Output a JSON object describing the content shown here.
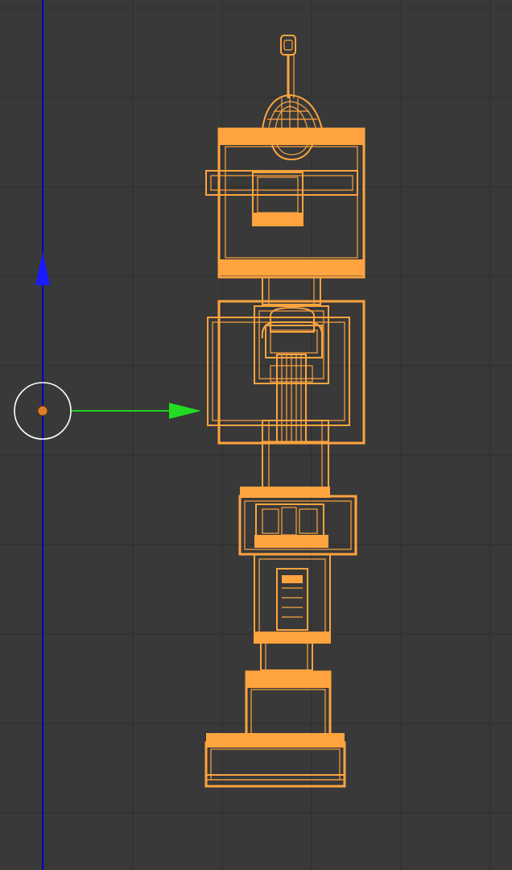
{
  "viewport": {
    "mode": "wireframe",
    "view": "orthographic-side"
  },
  "colors": {
    "background": "#393939",
    "grid_line": "#333333",
    "selected_wire": "#ffa43e",
    "axis_z": "#0000c8",
    "axis_y": "#1fd21f",
    "gizmo_y_arrow": "#22dd22",
    "gizmo_z_arrow": "#1a1aff",
    "origin_ring": "#ffffff",
    "origin_dot": "#e07d2c"
  },
  "icons": {
    "origin": "object-origin-icon",
    "z_arrow": "z-axis-arrow-icon",
    "y_arrow": "y-axis-arrow-icon"
  },
  "object": {
    "selected": true,
    "shape": "robot-tower-mesh"
  }
}
